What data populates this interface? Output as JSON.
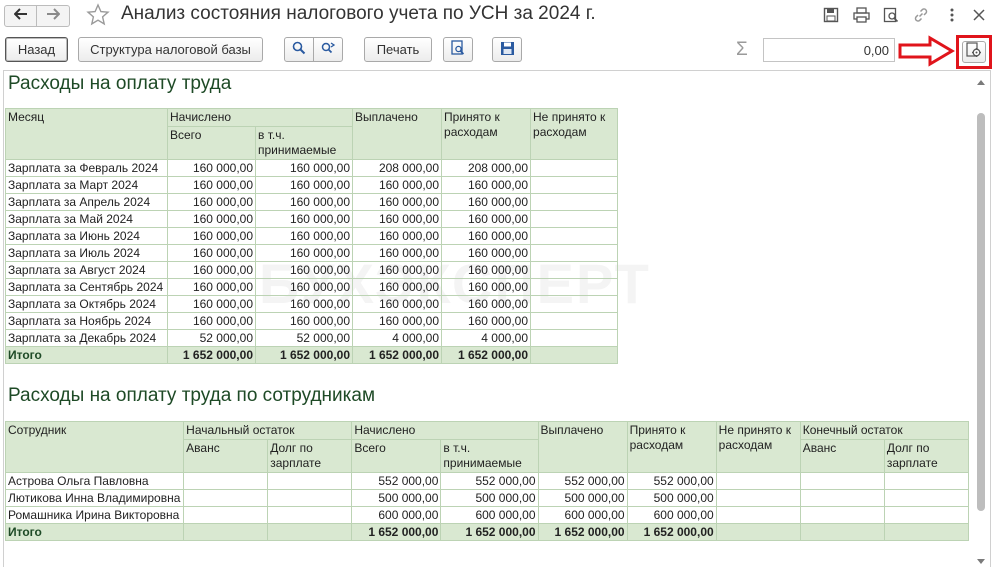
{
  "window": {
    "title": "Анализ состояния налогового учета по УСН за 2024 г."
  },
  "toolbar": {
    "back_label": "Назад",
    "structure_label": "Структура налоговой базы",
    "print_label": "Печать",
    "sum_value": "0,00"
  },
  "icons": {
    "back": "arrow-left-icon",
    "forward": "arrow-right-icon",
    "favorite": "star-icon",
    "save_window": "floppy-icon",
    "print_window": "printer-icon",
    "preview": "magnifier-doc-icon",
    "link": "link-icon",
    "more": "more-vertical-icon",
    "close": "close-icon",
    "search": "search-icon",
    "search_next": "search-next-icon",
    "sigma": "sigma-icon",
    "settings": "gear-doc-icon",
    "highlight_arrow": "red-arrow-icon"
  },
  "colors": {
    "header_bg": "#d9e8d1",
    "title_text": "#1e4a26",
    "highlight": "#e0141b"
  },
  "watermark": "БУХЭКСПЕРТ",
  "section1": {
    "title": "Расходы на оплату труда",
    "headers": {
      "month": "Месяц",
      "accrued": "Начислено",
      "total": "Всего",
      "incl": "в т.ч. принимаемые",
      "paid": "Выплачено",
      "accepted": "Принято к расходам",
      "not_accepted": "Не принято к расходам"
    },
    "rows": [
      {
        "month": "Зарплата за Февраль 2024",
        "total": "160 000,00",
        "incl": "160 000,00",
        "paid": "208 000,00",
        "accepted": "208 000,00",
        "not_accepted": ""
      },
      {
        "month": "Зарплата за Март 2024",
        "total": "160 000,00",
        "incl": "160 000,00",
        "paid": "160 000,00",
        "accepted": "160 000,00",
        "not_accepted": ""
      },
      {
        "month": "Зарплата за Апрель 2024",
        "total": "160 000,00",
        "incl": "160 000,00",
        "paid": "160 000,00",
        "accepted": "160 000,00",
        "not_accepted": ""
      },
      {
        "month": "Зарплата за Май 2024",
        "total": "160 000,00",
        "incl": "160 000,00",
        "paid": "160 000,00",
        "accepted": "160 000,00",
        "not_accepted": ""
      },
      {
        "month": "Зарплата за Июнь 2024",
        "total": "160 000,00",
        "incl": "160 000,00",
        "paid": "160 000,00",
        "accepted": "160 000,00",
        "not_accepted": ""
      },
      {
        "month": "Зарплата за Июль 2024",
        "total": "160 000,00",
        "incl": "160 000,00",
        "paid": "160 000,00",
        "accepted": "160 000,00",
        "not_accepted": ""
      },
      {
        "month": "Зарплата за Август 2024",
        "total": "160 000,00",
        "incl": "160 000,00",
        "paid": "160 000,00",
        "accepted": "160 000,00",
        "not_accepted": ""
      },
      {
        "month": "Зарплата за Сентябрь 2024",
        "total": "160 000,00",
        "incl": "160 000,00",
        "paid": "160 000,00",
        "accepted": "160 000,00",
        "not_accepted": ""
      },
      {
        "month": "Зарплата за Октябрь 2024",
        "total": "160 000,00",
        "incl": "160 000,00",
        "paid": "160 000,00",
        "accepted": "160 000,00",
        "not_accepted": ""
      },
      {
        "month": "Зарплата за Ноябрь 2024",
        "total": "160 000,00",
        "incl": "160 000,00",
        "paid": "160 000,00",
        "accepted": "160 000,00",
        "not_accepted": ""
      },
      {
        "month": "Зарплата за Декабрь 2024",
        "total": "52 000,00",
        "incl": "52 000,00",
        "paid": "4 000,00",
        "accepted": "4 000,00",
        "not_accepted": ""
      }
    ],
    "total": {
      "label": "Итого",
      "total": "1 652 000,00",
      "incl": "1 652 000,00",
      "paid": "1 652 000,00",
      "accepted": "1 652 000,00",
      "not_accepted": ""
    }
  },
  "section2": {
    "title": "Расходы на оплату труда по сотрудникам",
    "headers": {
      "employee": "Сотрудник",
      "opening": "Начальный остаток",
      "advance": "Аванс",
      "salary_debt": "Долг по зарплате",
      "accrued": "Начислено",
      "total": "Всего",
      "incl": "в т.ч. принимаемые",
      "paid": "Выплачено",
      "accepted": "Принято к расходам",
      "not_accepted": "Не принято к расходам",
      "closing": "Конечный остаток",
      "advance2": "Аванс",
      "salary_debt2": "Долг по зарплате"
    },
    "rows": [
      {
        "employee": "Астрова Ольга Павловна",
        "advance": "",
        "debt": "",
        "total": "552 000,00",
        "incl": "552 000,00",
        "paid": "552 000,00",
        "accepted": "552 000,00",
        "not_accepted": "",
        "advance2": "",
        "debt2": ""
      },
      {
        "employee": "Лютикова Инна Владимировна",
        "advance": "",
        "debt": "",
        "total": "500 000,00",
        "incl": "500 000,00",
        "paid": "500 000,00",
        "accepted": "500 000,00",
        "not_accepted": "",
        "advance2": "",
        "debt2": ""
      },
      {
        "employee": "Ромашника Ирина Викторовна",
        "advance": "",
        "debt": "",
        "total": "600 000,00",
        "incl": "600 000,00",
        "paid": "600 000,00",
        "accepted": "600 000,00",
        "not_accepted": "",
        "advance2": "",
        "debt2": ""
      }
    ],
    "total": {
      "label": "Итого",
      "total": "1 652 000,00",
      "incl": "1 652 000,00",
      "paid": "1 652 000,00",
      "accepted": "1 652 000,00"
    }
  }
}
